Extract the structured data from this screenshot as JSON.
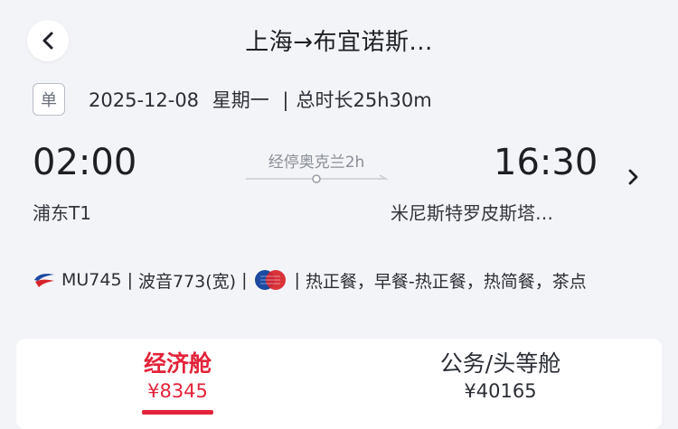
{
  "header": {
    "title": "上海→布宜诺斯..."
  },
  "trip": {
    "type_badge": "单",
    "date": "2025-12-08",
    "weekday": "星期一",
    "separator": "|",
    "duration": "总时长25h30m"
  },
  "flight": {
    "departure_time": "02:00",
    "departure_airport": "浦东T1",
    "arrival_time": "16:30",
    "arrival_airport": "米尼斯特罗皮斯塔…",
    "stop_info": "经停奥克兰2h"
  },
  "details": {
    "flight_number": "MU745",
    "aircraft": "波音773(宽)",
    "separator": "|",
    "meals": "热正餐，早餐-热正餐，热简餐，茶点"
  },
  "cabins": [
    {
      "name": "经济舱",
      "price": "¥8345",
      "selected": true
    },
    {
      "name": "公务/头等舱",
      "price": "¥40165",
      "selected": false
    }
  ],
  "colors": {
    "accent": "#e3233a",
    "background": "#f3f4f7",
    "airline_blue": "#1b4aa0",
    "airline_red": "#d8232a"
  },
  "icons": {
    "back": "chevron-left-icon",
    "detail": "chevron-right-icon",
    "airline": "china-eastern-logo-icon",
    "meal_partner": "meal-badge-icon"
  }
}
